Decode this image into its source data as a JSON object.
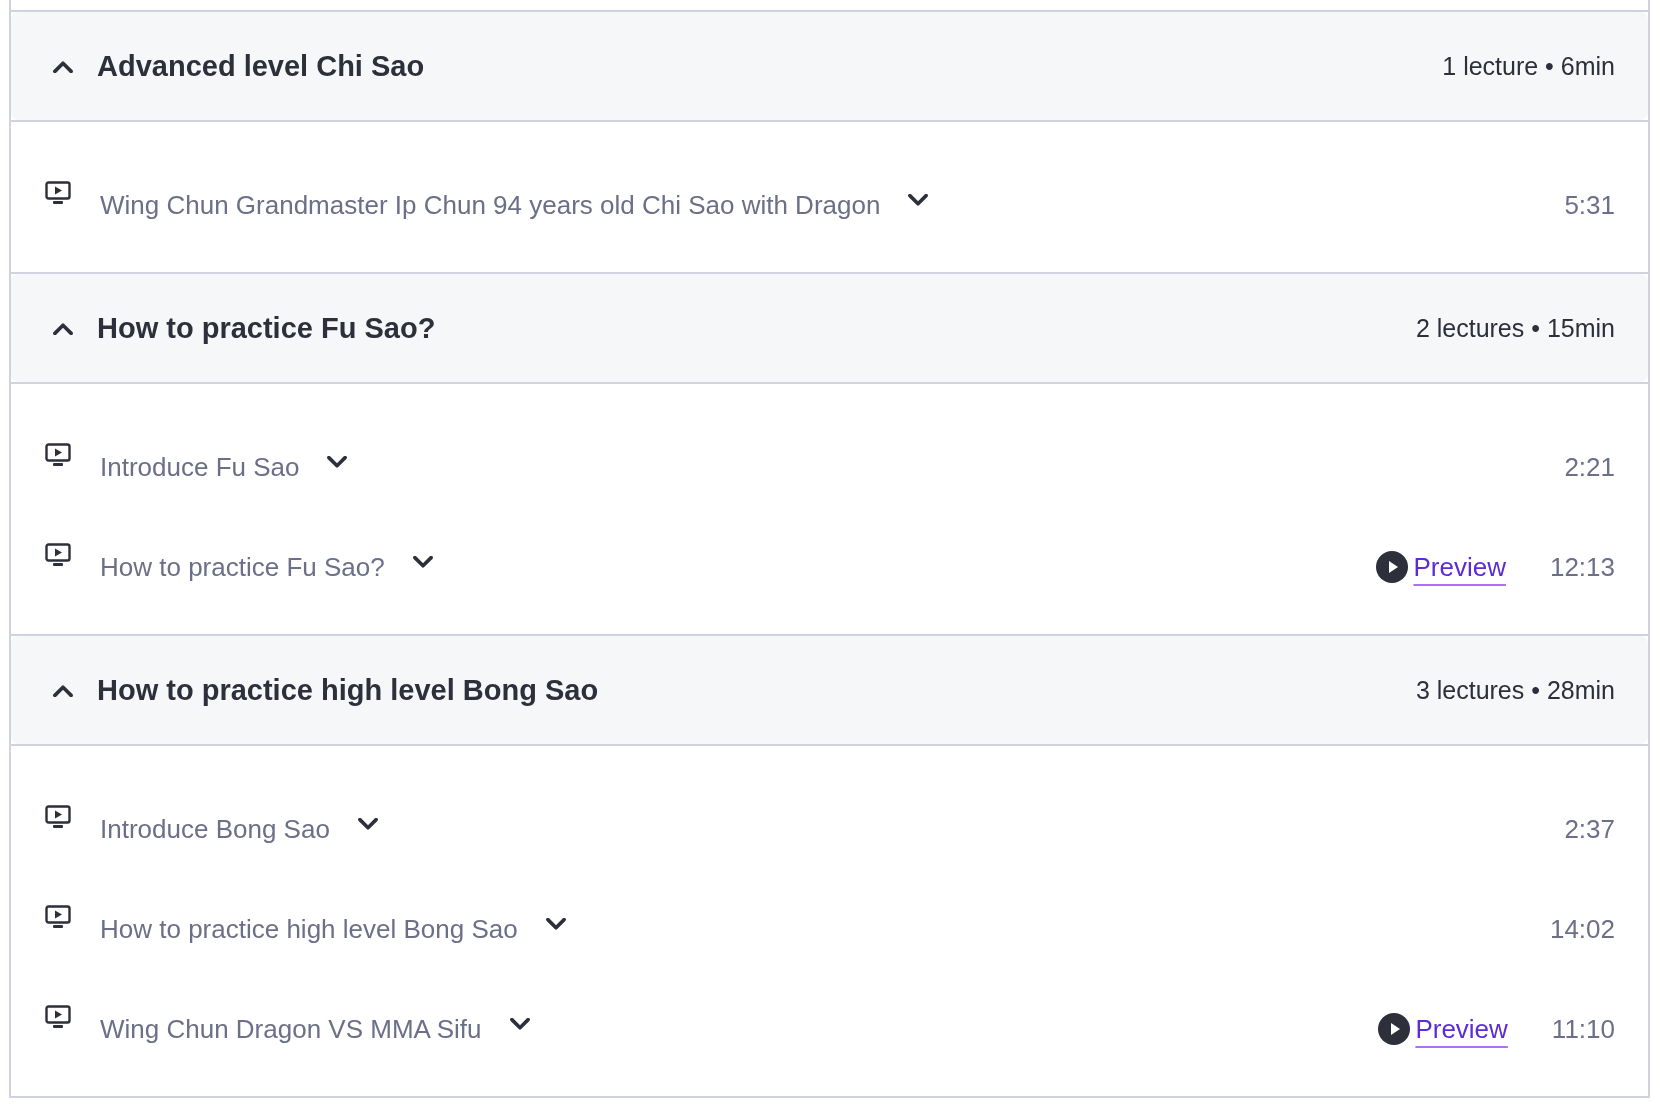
{
  "sections": [
    {
      "title": "Advanced level Chi Sao",
      "summary": "1 lecture • 6min",
      "expanded": true,
      "lectures": [
        {
          "title": "Wing Chun Grandmaster Ip Chun 94 years old Chi Sao with Dragon",
          "duration": "5:31"
        }
      ]
    },
    {
      "title": "How to practice Fu Sao?",
      "summary": "2 lectures • 15min",
      "expanded": true,
      "lectures": [
        {
          "title": "Introduce Fu Sao",
          "duration": "2:21"
        },
        {
          "title": "How to practice Fu Sao?",
          "duration": "12:13",
          "preview": "Preview"
        }
      ]
    },
    {
      "title": "How to practice high level Bong Sao",
      "summary": "3 lectures • 28min",
      "expanded": true,
      "lectures": [
        {
          "title": "Introduce Bong Sao",
          "duration": "2:37"
        },
        {
          "title": "How to practice high level Bong Sao",
          "duration": "14:02"
        },
        {
          "title": "Wing Chun Dragon VS MMA Sifu",
          "duration": "11:10",
          "preview": "Preview"
        }
      ]
    }
  ]
}
